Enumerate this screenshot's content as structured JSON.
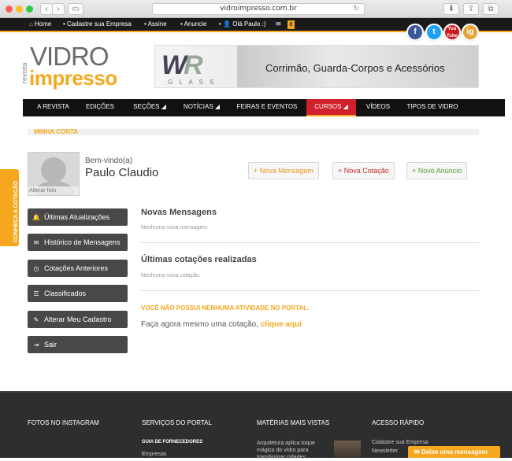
{
  "browser": {
    "url": "vidroimpresso.com.br"
  },
  "topbar": {
    "items": [
      "Home",
      "Cadastre sua Empresa",
      "Assine",
      "Anuncie",
      "Olá Paulo :)"
    ],
    "message_count": "0"
  },
  "social": [
    "f",
    "t",
    "You Tube",
    "ig"
  ],
  "logo": {
    "revista": "revista",
    "vidro": "VIDRO",
    "impresso": "impresso"
  },
  "banner": {
    "glass": "G L A S S",
    "text": "Corrimão, Guarda-Corpos e Acessórios"
  },
  "nav": [
    "A REVISTA",
    "EDIÇÕES",
    "SEÇÕES ◢",
    "NOTÍCIAS ◢",
    "FEIRAS E EVENTOS",
    "CURSOS ◢",
    "VÍDEOS",
    "TIPOS DE VIDRO"
  ],
  "section_label": "MINHA CONTA",
  "profile": {
    "change_photo": "Alterar foto",
    "welcome": "Bem-vindo(a)",
    "name": "Paulo Claudio"
  },
  "actions": [
    "Nova Mensagem",
    "Nova Cotação",
    "Novo Anúncio"
  ],
  "sidemenu": [
    "Últimas Atualizações",
    "Histórico de Mensagens",
    "Cotações Anteriores",
    "Classificados",
    "Alterar Meu Cadastro",
    "Sair"
  ],
  "content": {
    "messages_title": "Novas Mensagens",
    "messages_empty": "Nenhuma nova mensagem.",
    "quotes_title": "Últimas cotações realizadas",
    "quotes_empty": "Nenhuma nova cotação.",
    "no_activity": "VOCÊ NÃO POSSUI NENHUMA ATIVIDADE NO PORTAL.",
    "cta_text": "Faça agora mesmo uma cotação,",
    "cta_link": "clique aqui"
  },
  "sidetab": "CONHEÇA A COTAÇÃO",
  "footer": {
    "cols": [
      "FOTOS NO INSTAGRAM",
      "SERVIÇOS DO PORTAL",
      "MATÉRIAS MAIS VISTAS",
      "ACESSO RÁPIDO"
    ],
    "guide": "GUIA DE FORNECEDORES",
    "empresas": "Empresas",
    "article": "Arquitetura aplica toque mágico do vidro para transformar cidades",
    "quick1": "Cadastre sua Empresa",
    "quick2": "Newsletter"
  },
  "chat": "Deixe uma mensagem"
}
